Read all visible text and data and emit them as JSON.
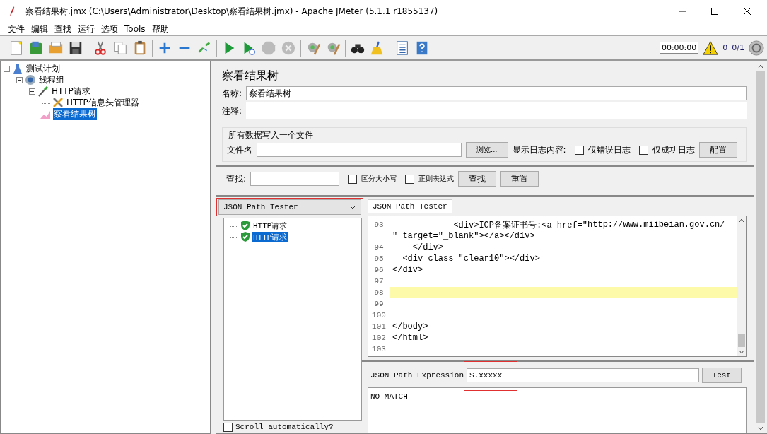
{
  "window": {
    "title": "察看结果树.jmx (C:\\Users\\Administrator\\Desktop\\察看结果树.jmx) - Apache JMeter (5.1.1 r1855137)"
  },
  "menu": [
    {
      "label": "文件"
    },
    {
      "label": "编辑"
    },
    {
      "label": "查找"
    },
    {
      "label": "运行"
    },
    {
      "label": "选项"
    },
    {
      "label": "Tools"
    },
    {
      "label": "帮助"
    }
  ],
  "toolbar_status": {
    "timer": "00:00:00",
    "warnings": "0",
    "threads": "0/1"
  },
  "tree": [
    {
      "label": "测试计划",
      "kind": "plan",
      "expanded": true,
      "selected": false,
      "children": [
        {
          "label": "线程组",
          "kind": "threads",
          "expanded": true,
          "selected": false,
          "children": [
            {
              "label": "HTTP请求",
              "kind": "sampler",
              "expanded": true,
              "selected": false,
              "children": [
                {
                  "label": "HTTP信息头管理器",
                  "kind": "config",
                  "selected": false
                }
              ]
            },
            {
              "label": "察看结果树",
              "kind": "listener",
              "selected": true
            }
          ]
        }
      ]
    }
  ],
  "panel": {
    "title": "察看结果树",
    "name_label": "名称:",
    "name_value": "察看结果树",
    "comment_label": "注释:",
    "file_group": {
      "legend": "所有数据写入一个文件",
      "file_label": "文件名",
      "browse": "浏览...",
      "log_label": "显示日志内容:",
      "options": [
        {
          "label": "仅错误日志",
          "checked": false
        },
        {
          "label": "仅成功日志",
          "checked": false
        }
      ],
      "configure": "配置"
    },
    "search": {
      "label": "查找:",
      "options": [
        {
          "label": "区分大小写",
          "checked": false
        },
        {
          "label": "正则表达式",
          "checked": false
        }
      ],
      "find": "查找",
      "reset": "重置"
    },
    "renderer": {
      "value": "JSON Path Tester",
      "annotated": true
    },
    "results": [
      {
        "label": "HTTP请求",
        "selected": false
      },
      {
        "label": "HTTP请求",
        "selected": true
      }
    ],
    "scroll_option": {
      "label": "Scroll automatically?",
      "checked": false
    },
    "tabs": [
      {
        "label": "JSON Path Tester",
        "selected": true
      }
    ],
    "code": [
      {
        "number": "93",
        "text": "            <div>ICP备案证书号:<a href=\"",
        "link": "http://www.miibeian.gov.cn/",
        "highlighted": false
      },
      {
        "text": "\" target=\"_blank\"></a></div>",
        "highlighted": false
      },
      {
        "number": "94",
        "text": "    </div>",
        "highlighted": false
      },
      {
        "number": "95",
        "text": "  <div class=\"clear10\"></div>",
        "highlighted": false
      },
      {
        "number": "96",
        "text": "</div>",
        "highlighted": false
      },
      {
        "number": "97",
        "highlighted": false
      },
      {
        "number": "98",
        "highlighted": true
      },
      {
        "number": "99",
        "highlighted": false
      },
      {
        "number": "100",
        "highlighted": false
      },
      {
        "number": "101",
        "text": "</body>",
        "highlighted": false
      },
      {
        "number": "102",
        "text": "</html>",
        "highlighted": false
      },
      {
        "number": "103",
        "highlighted": false
      }
    ],
    "expression": {
      "label": "JSON Path Expression",
      "value": "$.xxxxx",
      "annotated": true,
      "button": "Test"
    },
    "output": "NO MATCH"
  }
}
